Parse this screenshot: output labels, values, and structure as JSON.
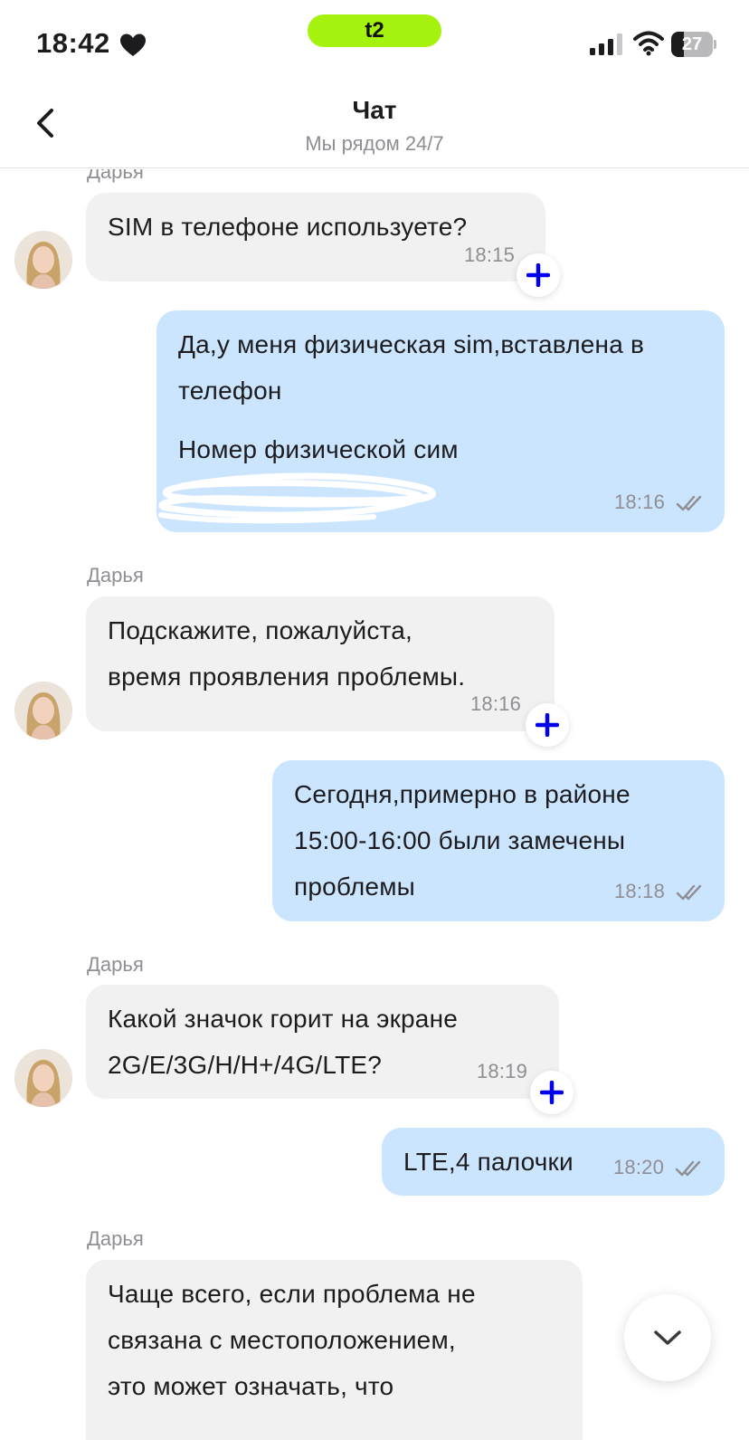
{
  "status_bar": {
    "time": "18:42",
    "carrier": "t2",
    "battery": "27",
    "colors": {
      "carrier_pill": "#a4f20d"
    }
  },
  "header": {
    "title": "Чат",
    "subtitle": "Мы рядом 24/7"
  },
  "messages": [
    {
      "direction": "in",
      "sender": "Дарья",
      "text": "SIM в телефоне используете?",
      "time": "18:15"
    },
    {
      "direction": "out",
      "paragraphs": [
        "Да,у меня физическая sim,вставлена в телефон",
        "Номер физической сим"
      ],
      "time": "18:16",
      "read": true
    },
    {
      "direction": "in",
      "sender": "Дарья",
      "text": "Подскажите, пожалуйста,\nвремя проявления проблемы.",
      "time": "18:16"
    },
    {
      "direction": "out",
      "text": "Сегодня,примерно в районе\n15:00-16:00 были замечены\nпроблемы",
      "time": "18:18",
      "read": true
    },
    {
      "direction": "in",
      "sender": "Дарья",
      "text": "Какой значок горит на экране\n2G/E/3G/H/H+/4G/LTE?",
      "time": "18:19"
    },
    {
      "direction": "out",
      "text": "LTE,4 палочки",
      "time": "18:20",
      "read": true
    },
    {
      "direction": "in",
      "sender": "Дарья",
      "text": "Чаще всего, если проблема не\nсвязана с местоположением,\nэто может означать, что"
    }
  ],
  "icons": {
    "back": "chevron-left-icon",
    "reaction": "plus-icon",
    "scroll": "chevron-down-icon",
    "read": "double-check-icon"
  },
  "colors": {
    "incoming_bubble": "#f1f1f2",
    "outgoing_bubble": "#cce5ff",
    "reaction_plus": "#0000ee"
  }
}
